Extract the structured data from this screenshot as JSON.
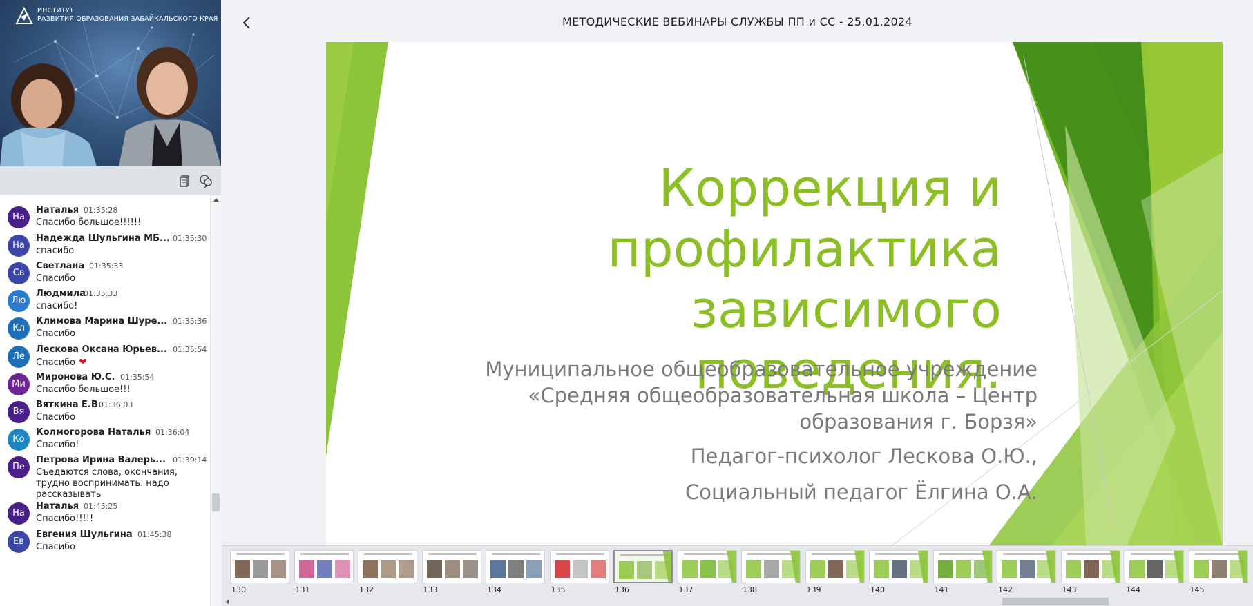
{
  "header": {
    "title": "МЕТОДИЧЕСКИЕ ВЕБИНАРЫ СЛУЖБЫ ПП и СС - 25.01.2024"
  },
  "video": {
    "brand_line1": "ИНСТИТУТ",
    "brand_line2": "РАЗВИТИЯ ОБРАЗОВАНИЯ ЗАБАЙКАЛЬСКОГО КРАЯ"
  },
  "toolbar": {
    "icons": [
      "notes-icon",
      "chat-bubbles-icon"
    ]
  },
  "chat": {
    "messages": [
      {
        "initials": "На",
        "color": "#4a1f8a",
        "name": "Наталья",
        "time": "01:35:28",
        "text": "Спасибо большое!!!!!!"
      },
      {
        "initials": "На",
        "color": "#3b46a6",
        "name": "Надежда Шульгина МБ...",
        "time": "01:35:30",
        "text": "спасибо"
      },
      {
        "initials": "Св",
        "color": "#3b46a6",
        "name": "Светлана",
        "time": "01:35:33",
        "text": "Спасибо"
      },
      {
        "initials": "Лю",
        "color": "#2b7bd0",
        "name": "Людмила",
        "time": "01:35:33",
        "text": "спасибо!"
      },
      {
        "initials": "Кл",
        "color": "#1e6fb8",
        "name": "Климова Марина Шуре...",
        "time": "01:35:36",
        "text": "Спасибо"
      },
      {
        "initials": "Ле",
        "color": "#1e6fb8",
        "name": "Лескова Оксана Юрьев...",
        "time": "01:35:54",
        "text": "Спасибо",
        "heart": "❤"
      },
      {
        "initials": "Ми",
        "color": "#6e2596",
        "name": "Миронова Ю.С.",
        "time": "01:35:54",
        "text": "Спасибо большое!!!"
      },
      {
        "initials": "Вя",
        "color": "#4a1f8a",
        "name": "Вяткина Е.В.",
        "time": "01:36:03",
        "text": "Спасибо"
      },
      {
        "initials": "Ко",
        "color": "#1e86c2",
        "name": "Колмогорова Наталья",
        "time": "01:36:04",
        "text": "Спасибо!"
      },
      {
        "initials": "Пе",
        "color": "#4a1f8a",
        "name": "Петрова Ирина Валерь...",
        "time": "01:39:14",
        "text": "Съедаются слова, окончания, трудно воспринимать. надо рассказывать"
      },
      {
        "initials": "На",
        "color": "#4a1f8a",
        "name": "Наталья",
        "time": "01:45:25",
        "text": "Спасибо!!!!!"
      },
      {
        "initials": "Ев",
        "color": "#3b46a6",
        "name": "Евгения Шульгина",
        "time": "01:45:38",
        "text": "Спасибо"
      }
    ]
  },
  "slide": {
    "title_line1": "Коррекция и",
    "title_line2": "профилактика",
    "title_line3": "зависимого поведения.",
    "org_line1": "Муниципальное общеобразовательное учреждение",
    "org_line2": "«Средняя общеобразовательная школа – Центр",
    "org_line3": "образования г. Борзя»",
    "person1": "Педагог-психолог Лескова О.Ю.,",
    "person2": "Социальный педагог Ёлгина О.А.",
    "accent": "#8cbf26"
  },
  "filmstrip": {
    "active": "136",
    "items": [
      {
        "num": "130"
      },
      {
        "num": "131"
      },
      {
        "num": "132"
      },
      {
        "num": "133"
      },
      {
        "num": "134"
      },
      {
        "num": "135"
      },
      {
        "num": "136"
      },
      {
        "num": "137"
      },
      {
        "num": "138"
      },
      {
        "num": "139"
      },
      {
        "num": "140"
      },
      {
        "num": "141"
      },
      {
        "num": "142"
      },
      {
        "num": "143"
      },
      {
        "num": "144"
      },
      {
        "num": "145"
      }
    ]
  }
}
